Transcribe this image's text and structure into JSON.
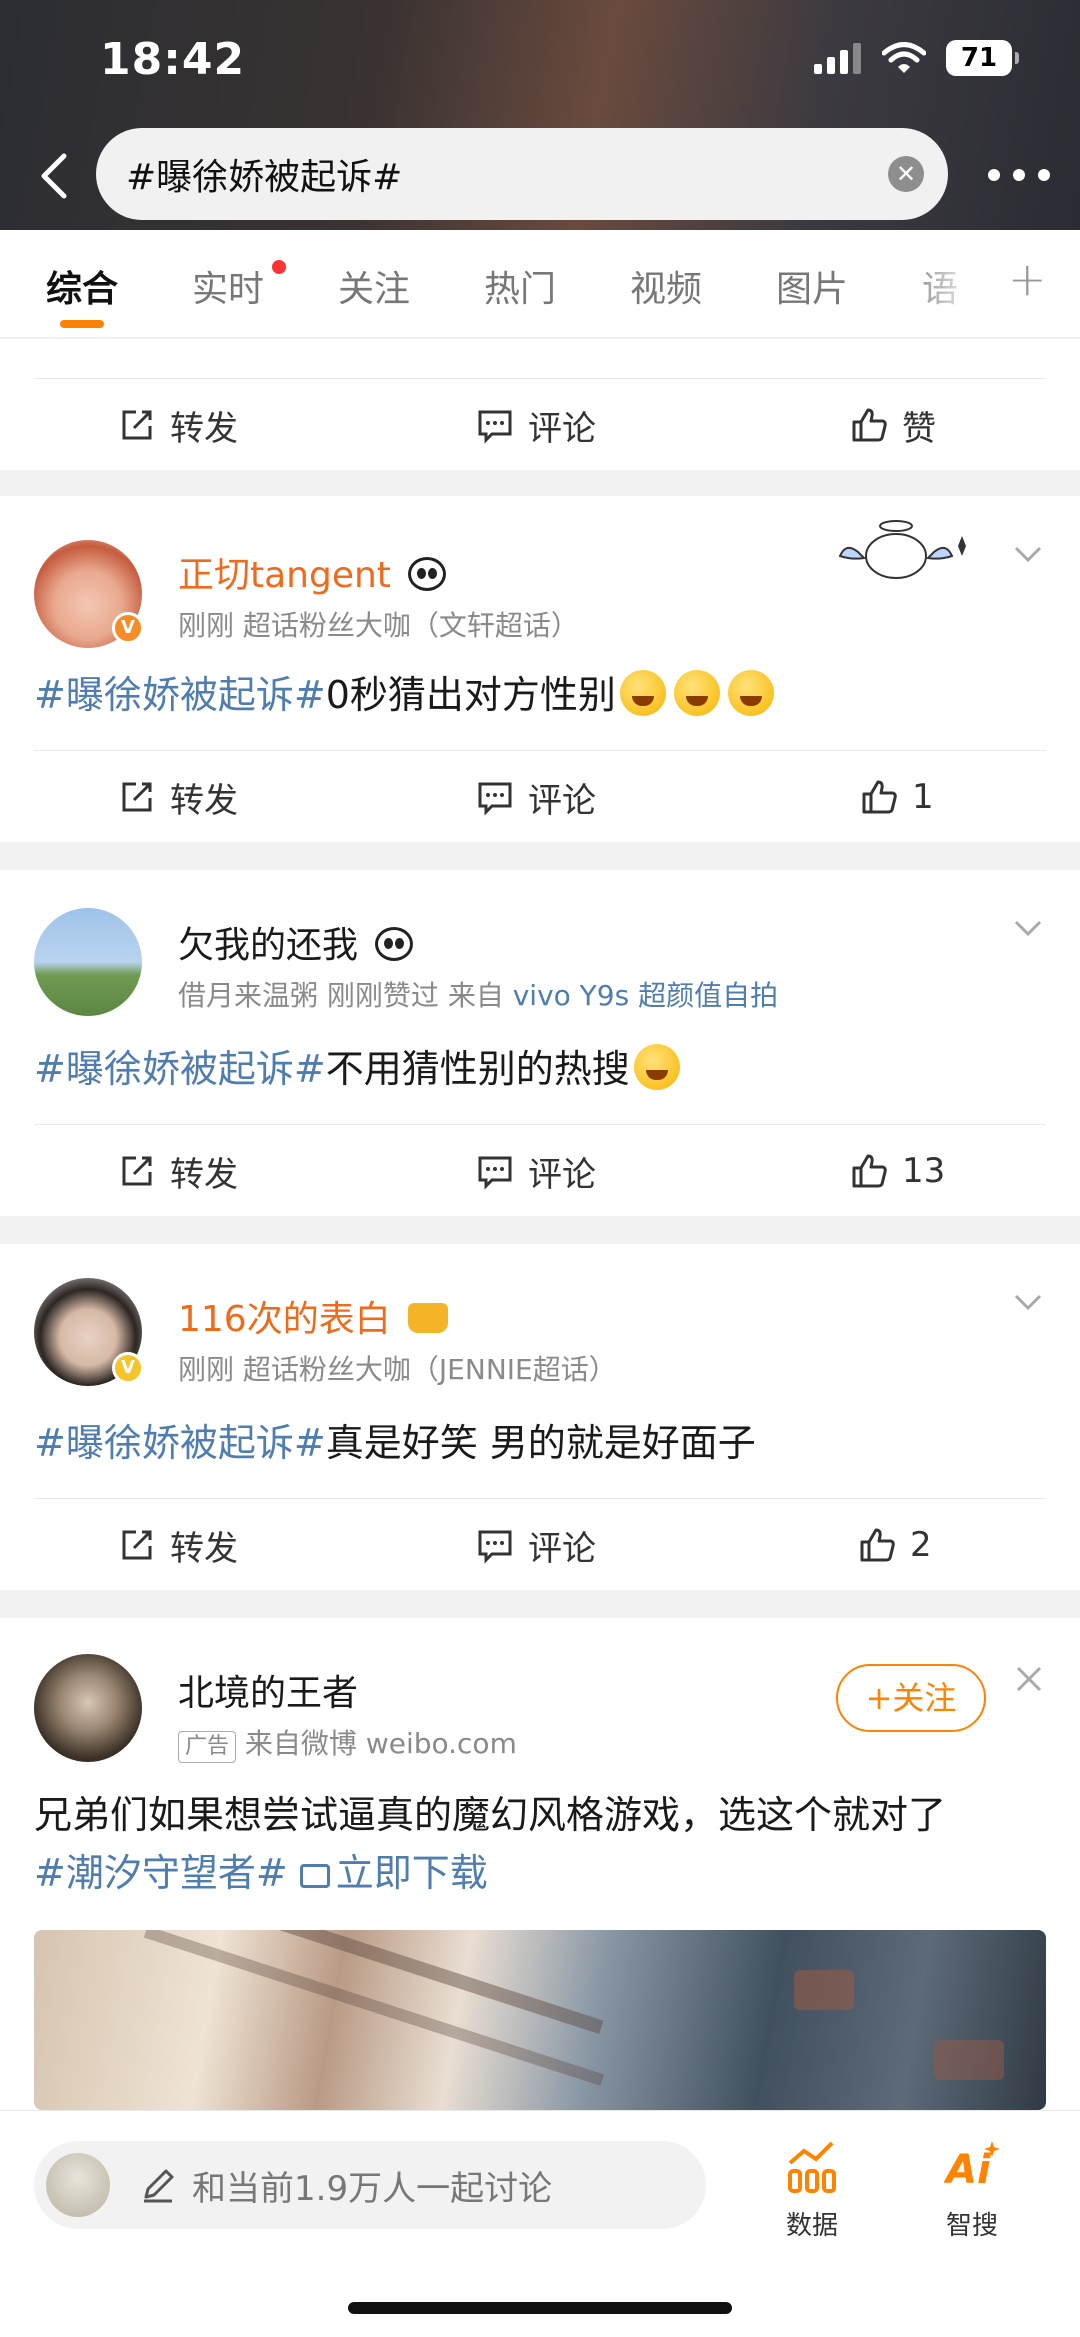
{
  "status_bar": {
    "time": "18:42",
    "battery": "71"
  },
  "search": {
    "query": "#曝徐娇被起诉#"
  },
  "tabs": [
    "综合",
    "实时",
    "关注",
    "热门",
    "视频",
    "图片",
    "语"
  ],
  "actions": {
    "repost": "转发",
    "comment": "评论",
    "like_default": "赞"
  },
  "posts": [
    {
      "username": "正切tangent",
      "meta_time": "刚刚",
      "meta_info": "超话粉丝大咖（文轩超话）",
      "topic": "#曝徐娇被起诉#",
      "text": "0秒猜出对方性别",
      "likes": "1"
    },
    {
      "username": "欠我的还我",
      "meta_time": "借月来温粥 刚刚赞过",
      "meta_source_prefix": "来自",
      "meta_source": "vivo Y9s 超颜值自拍",
      "topic": "#曝徐娇被起诉#",
      "text": "不用猜性别的热搜",
      "likes": "13"
    },
    {
      "username": "116次的表白",
      "meta_time": "刚刚",
      "meta_info": "超话粉丝大咖（JENNIE超话）",
      "topic": "#曝徐娇被起诉#",
      "text": "真是好笑 男的就是好面子",
      "likes": "2"
    }
  ],
  "ad": {
    "username": "北境的王者",
    "follow_label": "+关注",
    "ad_tag": "广告",
    "source": "来自微博 weibo.com",
    "text": "兄弟们如果想尝试逼真的魔幻风格游戏，选这个就对了",
    "topic": "#潮汐守望者#",
    "link": "立即下载"
  },
  "bottom_bar": {
    "placeholder": "和当前1.9万人一起讨论",
    "data_label": "数据",
    "smart_search_label": "智搜"
  },
  "colors": {
    "accent": "#ff8200",
    "topic_blue": "#507daf",
    "username_orange": "#f06a1a"
  }
}
